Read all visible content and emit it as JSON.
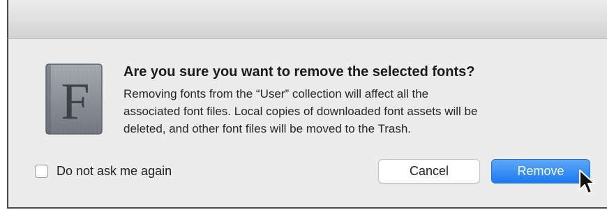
{
  "dialog": {
    "heading": "Are you sure you want to remove the selected fonts?",
    "body_lines": [
      "Removing fonts from the “User” collection will affect all the",
      "associated font files. Local copies of downloaded font assets will be",
      "deleted, and other font files will be moved to the Trash."
    ],
    "app_icon": {
      "name": "font-book-icon",
      "letter": "F"
    },
    "checkbox": {
      "label": "Do not ask me again",
      "checked": false
    },
    "buttons": {
      "cancel_label": "Cancel",
      "remove_label": "Remove"
    },
    "colors": {
      "primary_button": "#1a79f1",
      "dialog_background": "#ececec"
    }
  }
}
